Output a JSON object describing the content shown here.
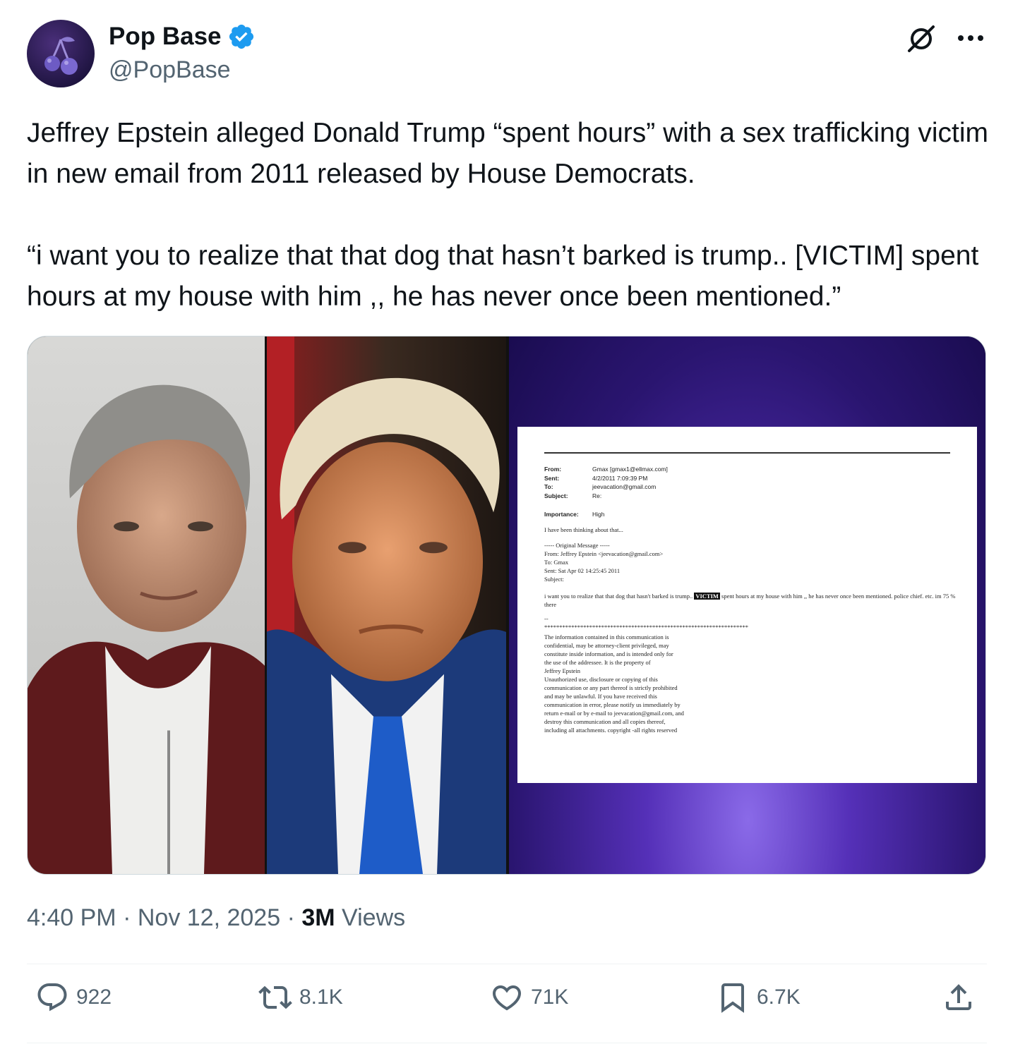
{
  "author": {
    "display_name": "Pop Base",
    "handle": "@PopBase",
    "verified": true,
    "avatar_icon": "cherry-icon"
  },
  "tweet": {
    "paragraph1": "Jeffrey Epstein alleged Donald Trump “spent hours” with a sex trafficking victim in new email from 2011 released by House Democrats.",
    "paragraph2": "“i want you to realize that that dog that hasn’t barked is trump.. [VICTIM] spent hours at my house with him ,, he has never once been mentioned.”"
  },
  "email": {
    "headers": [
      {
        "key": "From:",
        "value": "Gmax [gmax1@ellmax.com]"
      },
      {
        "key": "Sent:",
        "value": "4/2/2011 7:09:39 PM"
      },
      {
        "key": "To:",
        "value": "jeevacation@gmail.com"
      },
      {
        "key": "Subject:",
        "value": "Re:"
      }
    ],
    "importance_key": "Importance:",
    "importance_value": "High",
    "reply_line": "I have been thinking about that...",
    "original_lines": [
      "----- Original Message -----",
      "From: Jeffrey Epstein <jeevacation@gmail.com>",
      "To: Gmax",
      "Sent: Sat Apr 02 14:25:45 2011",
      "Subject:"
    ],
    "body_before": "i want you to realize that that dog that hasn't barked is trump..",
    "victim_label": "VICTIM",
    "body_after": "spent hours at my house with him ,, he has never once been mentioned.  police chief. etc.  im 75 % there",
    "separator": "--",
    "stars": "********************************************************************",
    "disclaimer": [
      "The information contained in this communication is",
      "confidential, may be attorney-client privileged, may",
      "constitute inside information, and is intended only for",
      "the use of the addressee. It is the property of",
      "Jeffrey Epstein",
      "Unauthorized use, disclosure or copying of this",
      "communication or any part thereof is strictly prohibited",
      "and may be unlawful. If you have received this",
      "communication in error, please notify us immediately by",
      "return e-mail or by e-mail to jeevacation@gmail.com, and",
      "destroy this communication and all copies thereof,",
      "including all attachments. copyright -all rights reserved"
    ]
  },
  "meta": {
    "time": "4:40 PM",
    "dot1": "·",
    "date": "Nov 12, 2025",
    "dot2": "·",
    "views_count": "3M",
    "views_label": "Views"
  },
  "actions": {
    "replies": "922",
    "reposts": "8.1K",
    "likes": "71K",
    "bookmarks": "6.7K"
  },
  "colors": {
    "text": "#0f1419",
    "secondary": "#536471",
    "verified": "#1d9bf0",
    "divider": "#eff3f4"
  }
}
